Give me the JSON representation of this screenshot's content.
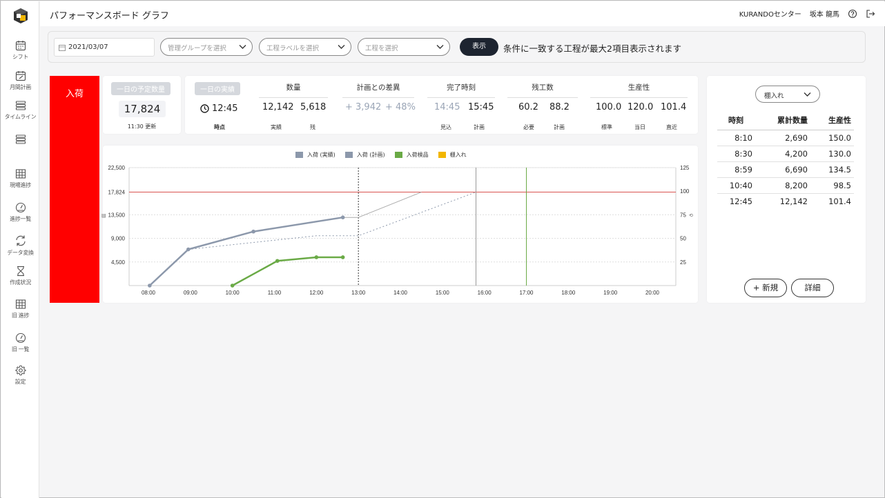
{
  "sidebar": {
    "items": [
      {
        "label": "シフト",
        "icon": "calendar-icon"
      },
      {
        "label": "月間計画",
        "icon": "calendar-edit-icon"
      },
      {
        "label": "タイムライン",
        "icon": "timeline-icon"
      },
      {
        "label": "",
        "icon": "timeline-alt-icon"
      },
      {
        "label": "現場進捗",
        "icon": "grid-icon"
      },
      {
        "label": "進捗一覧",
        "icon": "gauge-icon"
      },
      {
        "label": "データ変換",
        "icon": "sync-icon"
      },
      {
        "label": "作成状況",
        "icon": "hourglass-icon"
      },
      {
        "label": "旧 進捗",
        "icon": "grid-icon"
      },
      {
        "label": "旧 一覧",
        "icon": "gauge-icon"
      },
      {
        "label": "設定",
        "icon": "gear-icon"
      }
    ]
  },
  "header": {
    "title": "パフォーマンスボード グラフ",
    "center_name": "KURANDOセンター",
    "user_name": "坂本 龍馬"
  },
  "filters": {
    "date": "2021/03/07",
    "group_placeholder": "管理グループを選択",
    "label_placeholder": "工程ラベルを選択",
    "process_placeholder": "工程を選択",
    "show_button": "表示",
    "note": "条件に一致する工程が最大2項目表示されます"
  },
  "category": {
    "label": "入荷",
    "color": "#ff0000"
  },
  "plan": {
    "title": "一日の予定数量",
    "value": "17,824",
    "updated": "11:30 更新"
  },
  "stats": {
    "actual_title": "一日の実績",
    "time": "12:45",
    "time_label": "時点",
    "qty": {
      "title": "数量",
      "actual": "12,142",
      "actual_label": "実績",
      "remaining": "5,618",
      "remaining_label": "残"
    },
    "diff": {
      "title": "計画との差異",
      "amount": "+ 3,942",
      "percent": "+ 48%"
    },
    "finish": {
      "title": "完了時刻",
      "forecast": "14:45",
      "forecast_label": "見込",
      "plan": "15:45",
      "plan_label": "計画"
    },
    "remaining_work": {
      "title": "残工数",
      "required": "60.2",
      "required_label": "必要",
      "plan": "88.2",
      "plan_label": "計画"
    },
    "productivity": {
      "title": "生産性",
      "standard": "100.0",
      "standard_label": "標準",
      "today": "120.0",
      "today_label": "当日",
      "recent": "101.4",
      "recent_label": "直近"
    }
  },
  "chart_data": {
    "type": "line",
    "legend": [
      "入荷 (実績)",
      "入荷 (計画)",
      "入荷検品",
      "棚入れ"
    ],
    "legend_colors": [
      "#8c98ab",
      "#8c98ab",
      "#6aaa46",
      "#f2b600"
    ],
    "x_ticks": [
      "08:00",
      "09:00",
      "10:00",
      "11:00",
      "12:00",
      "13:00",
      "14:00",
      "15:00",
      "16:00",
      "17:00",
      "18:00",
      "19:00",
      "20:00"
    ],
    "y_left_ticks": [
      "22,500",
      "17,824",
      "13,500",
      "9,000",
      "4,500"
    ],
    "y_left_values": [
      22500,
      17824,
      13500,
      9000,
      4500
    ],
    "y_right_ticks": [
      "125",
      "100",
      "75",
      "50",
      "25"
    ],
    "y_right_values": [
      125,
      100,
      75,
      50,
      25
    ],
    "ylim": [
      0,
      22500
    ],
    "y2lim": [
      0,
      125
    ],
    "target": 17824,
    "series": [
      {
        "name": "入荷 (実績)",
        "color": "#8c98ab",
        "x": [
          8.03,
          8.95,
          10.5,
          12.63,
          13.0
        ],
        "y": [
          0,
          6900,
          10300,
          13000,
          13000
        ],
        "styles": [
          "solid",
          "solid",
          "solid",
          "solid"
        ]
      },
      {
        "name": "入荷 (計画)",
        "color": "#8c98ab",
        "x": [
          8.95,
          12.0,
          13.0,
          15.8
        ],
        "y": [
          6900,
          9500,
          9500,
          17824
        ],
        "dashed": true
      },
      {
        "name": "入荷検品",
        "color": "#6aaa46",
        "x": [
          10.0,
          11.07,
          12.0,
          12.63
        ],
        "y": [
          0,
          4700,
          5400,
          5400
        ]
      }
    ],
    "forecast_line": {
      "x": [
        13.0,
        14.5
      ],
      "y": [
        13000,
        17824
      ]
    },
    "current_time": 13.0,
    "forecast_finish": 15.8,
    "plan_finish": 17.0
  },
  "right_panel": {
    "select": "棚入れ",
    "columns": [
      "時刻",
      "累計数量",
      "生産性"
    ],
    "rows": [
      [
        "8:10",
        "2,690",
        "150.0"
      ],
      [
        "8:30",
        "4,200",
        "130.0"
      ],
      [
        "8:59",
        "6,690",
        "134.5"
      ],
      [
        "10:40",
        "8,200",
        "98.5"
      ],
      [
        "12:45",
        "12,142",
        "101.4"
      ]
    ],
    "new_button": "+ 新規",
    "detail_button": "詳細"
  }
}
